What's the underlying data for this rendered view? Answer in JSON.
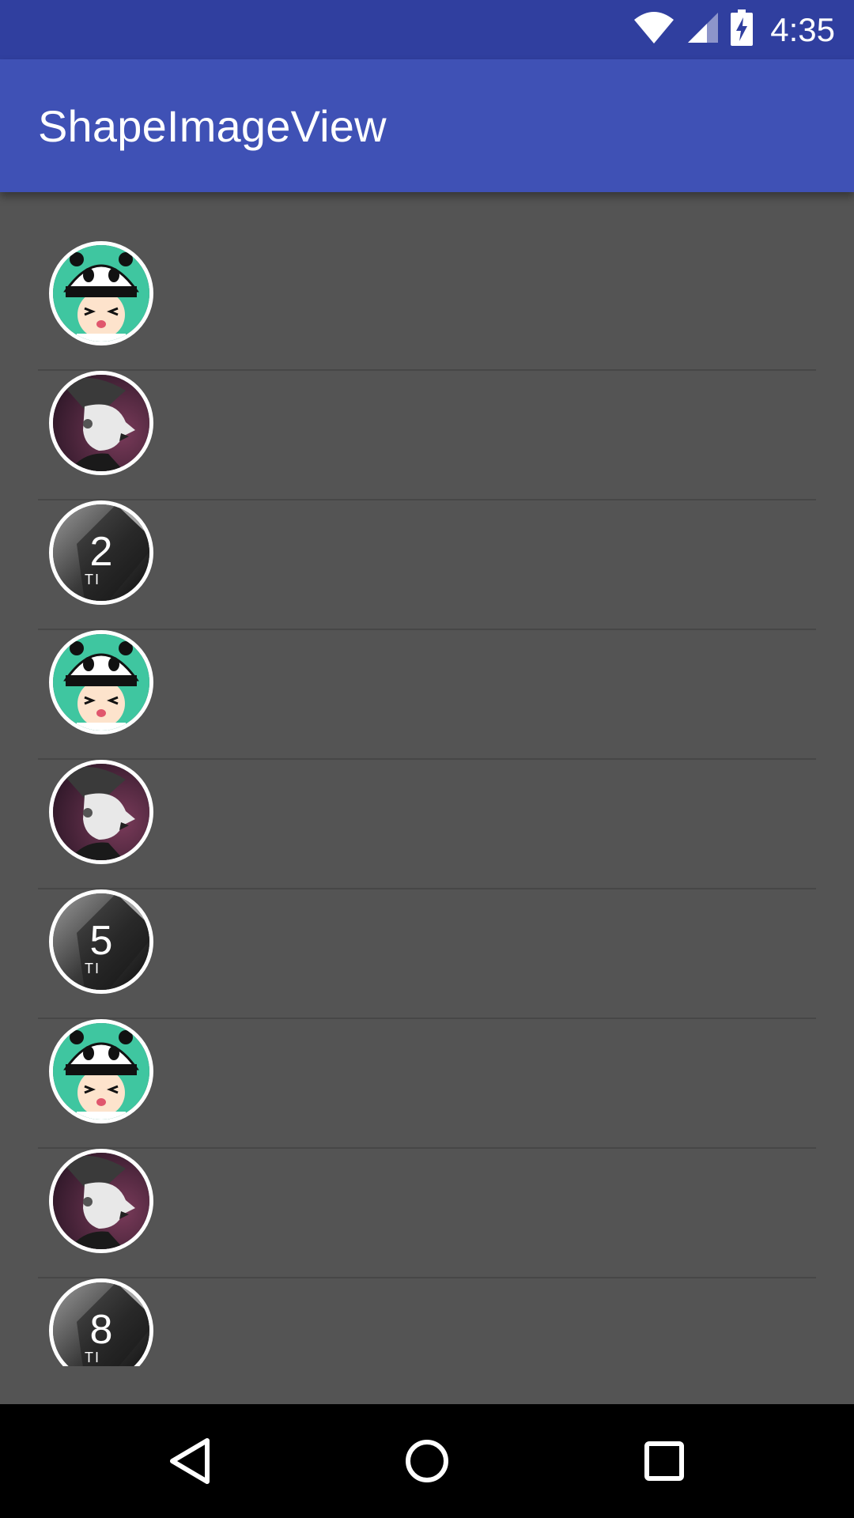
{
  "status_bar": {
    "time": "4:35",
    "icons": [
      "wifi-icon",
      "cell-signal-icon",
      "battery-charging-icon"
    ]
  },
  "app_bar": {
    "title": "ShapeImageView"
  },
  "colors": {
    "status_bar": "#303f9f",
    "app_bar": "#3f51b5",
    "background": "#545454",
    "divider": "#474747",
    "avatar_border": "#ffffff",
    "nav_bar": "#000000"
  },
  "list": {
    "items": [
      {
        "image": "panda-hat-cartoon"
      },
      {
        "image": "masked-man-profile"
      },
      {
        "image": "number-card",
        "number": "2",
        "caption": "TI"
      },
      {
        "image": "panda-hat-cartoon"
      },
      {
        "image": "masked-man-profile"
      },
      {
        "image": "number-card",
        "number": "5",
        "caption": "TI"
      },
      {
        "image": "panda-hat-cartoon"
      },
      {
        "image": "masked-man-profile"
      },
      {
        "image": "number-card",
        "number": "8",
        "caption": "TI"
      }
    ]
  },
  "nav_bar": {
    "buttons": [
      "back-icon",
      "home-icon",
      "recents-icon"
    ]
  }
}
